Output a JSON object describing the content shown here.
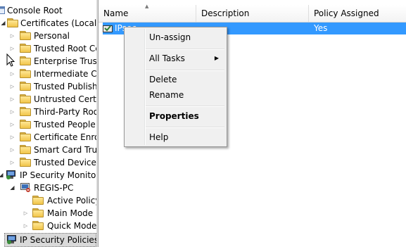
{
  "tree": {
    "console_root": "Console Root",
    "certificates": "Certificates (Local Computer)",
    "cert_children": [
      "Personal",
      "Trusted Root Certification Authorities",
      "Enterprise Trust",
      "Intermediate Certification Authorities",
      "Trusted Publishers",
      "Untrusted Certificates",
      "Third-Party Root Certification Authorities",
      "Trusted People",
      "Certificate Enrollment Requests",
      "Smart Card Trusted Roots",
      "Trusted Devices"
    ],
    "ip_monitor": "IP Security Monitor",
    "regis_pc": "REGIS-PC",
    "monitor_children": [
      "Active Policy",
      "Main Mode",
      "Quick Mode"
    ],
    "ip_policies": "IP Security Policies on Local Computer"
  },
  "list": {
    "columns": [
      "Name",
      "Description",
      "Policy Assigned"
    ],
    "row": {
      "name": "IPsec",
      "description": "",
      "assigned": "Yes"
    }
  },
  "menu": {
    "items": [
      "Un-assign",
      "All Tasks",
      "Delete",
      "Rename",
      "Properties",
      "Help"
    ]
  },
  "colors": {
    "selection": "#3399ff",
    "folder": "#f1c54a"
  }
}
